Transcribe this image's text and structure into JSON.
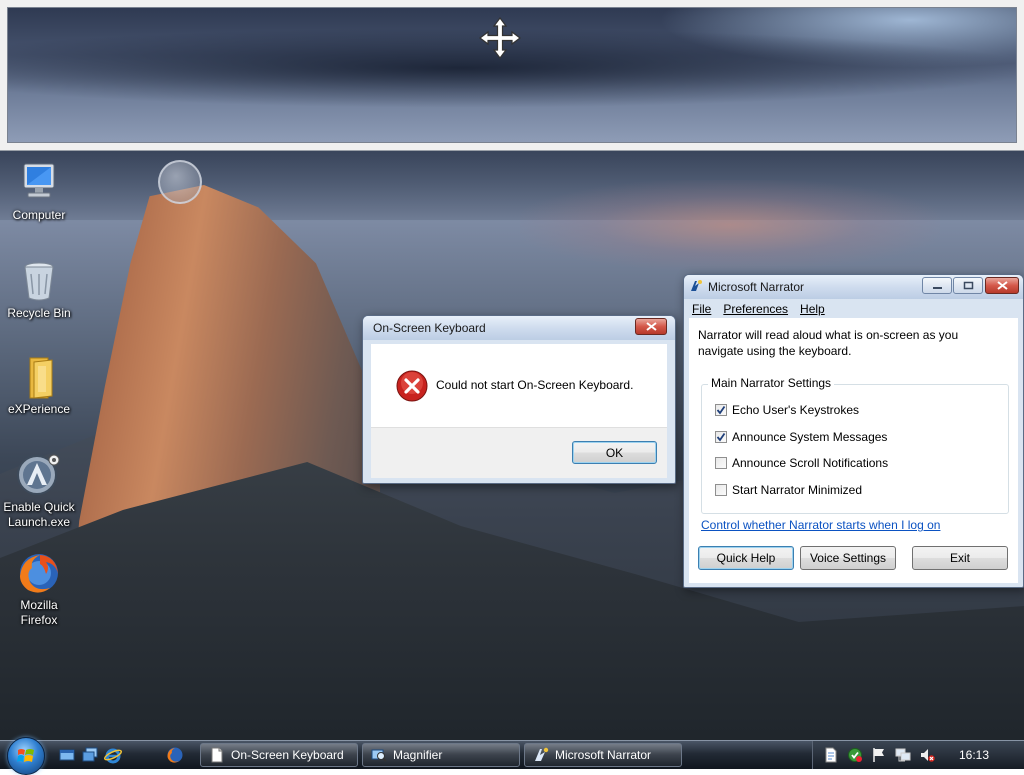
{
  "desktop": {
    "icons": [
      {
        "label_line1": "Computer",
        "label_line2": "",
        "icon": "computer-icon"
      },
      {
        "label_line1": "Recycle Bin",
        "label_line2": "",
        "icon": "recycle-bin-icon"
      },
      {
        "label_line1": "eXPerience",
        "label_line2": "",
        "icon": "folder-icon"
      },
      {
        "label_line1": "Enable Quick",
        "label_line2": "Launch.exe",
        "icon": "app-icon"
      },
      {
        "label_line1": "Mozilla",
        "label_line2": "Firefox",
        "icon": "firefox-icon"
      }
    ]
  },
  "magnifier": {
    "cursor_icon": "move-cursor-icon"
  },
  "osk_dialog": {
    "title": "On-Screen Keyboard",
    "message": "Could not start On-Screen Keyboard.",
    "ok_label": "OK",
    "icon": "error-icon"
  },
  "narrator": {
    "title": "Microsoft Narrator",
    "menu": [
      "File",
      "Preferences",
      "Help"
    ],
    "description": "Narrator will read aloud what is on-screen as you navigate using the keyboard.",
    "group_label": "Main Narrator Settings",
    "options": [
      {
        "label": "Echo User's Keystrokes",
        "checked": true
      },
      {
        "label": "Announce System Messages",
        "checked": true
      },
      {
        "label": "Announce Scroll Notifications",
        "checked": false
      },
      {
        "label": "Start Narrator Minimized",
        "checked": false
      }
    ],
    "link": "Control whether Narrator starts when I log on",
    "buttons": [
      "Quick Help",
      "Voice Settings",
      "Exit"
    ]
  },
  "taskbar": {
    "quick_launch": [
      "show-desktop-icon",
      "switch-windows-icon",
      "internet-explorer-icon",
      "firefox-icon"
    ],
    "tasks": [
      {
        "label": "On-Screen Keyboard",
        "icon": "document-icon"
      },
      {
        "label": "Magnifier",
        "icon": "magnifier-icon"
      },
      {
        "label": "Microsoft Narrator",
        "icon": "narrator-icon"
      }
    ],
    "tray_icons": [
      "document-icon",
      "security-icon",
      "flag-icon",
      "network-icon",
      "volume-muted-icon"
    ],
    "clock": "16:13"
  },
  "colors": {
    "link": "#0b52c2",
    "close_button": "#c74535",
    "taskbar": "#1c232d"
  }
}
